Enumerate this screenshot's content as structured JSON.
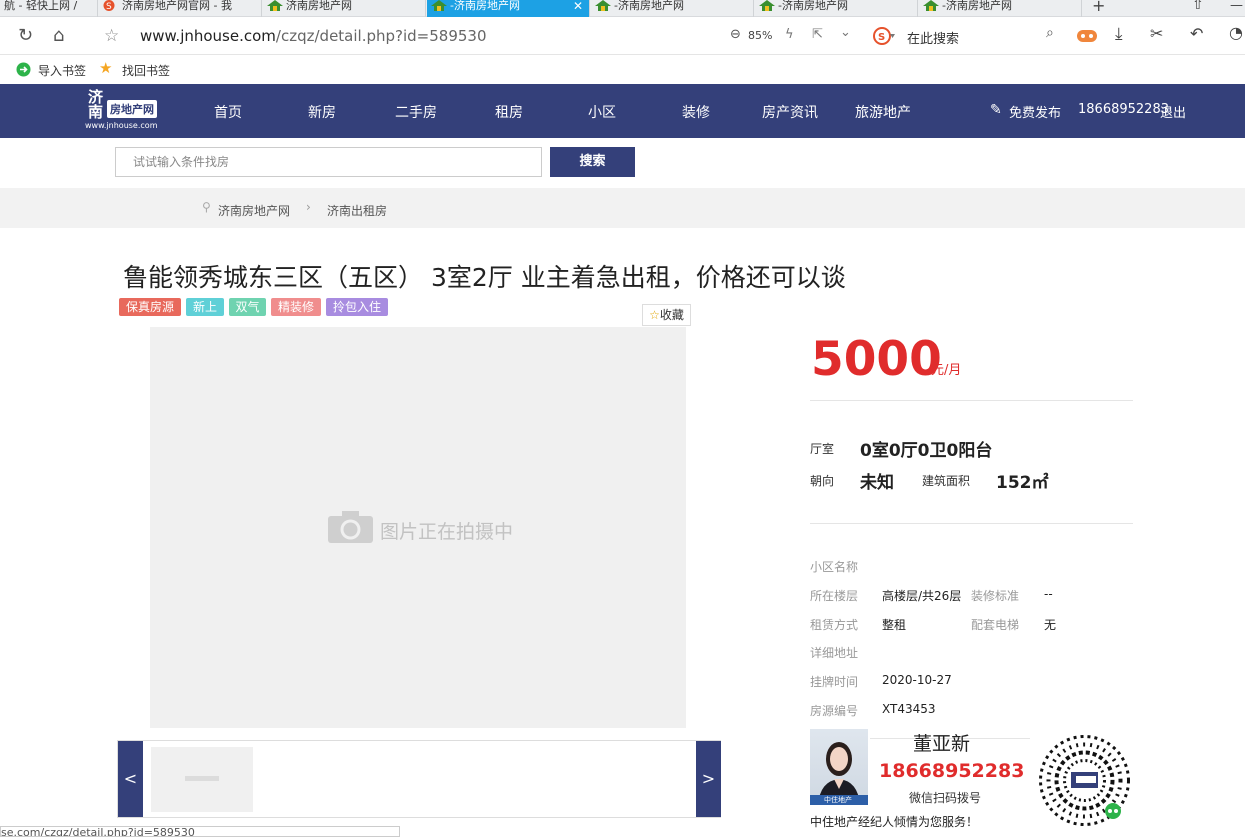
{
  "browser": {
    "tabs": [
      {
        "label": "航 - 轻快上网 /",
        "active": false
      },
      {
        "label": "济南房地产网官网 - 我",
        "active": false
      },
      {
        "label": "济南房地产网",
        "active": false
      },
      {
        "label": "-济南房地产网",
        "active": true
      },
      {
        "label": "-济南房地产网",
        "active": false
      },
      {
        "label": "-济南房地产网",
        "active": false
      },
      {
        "label": "-济南房地产网",
        "active": false
      }
    ],
    "new_tab": "+",
    "url_host": "www.jnhouse.com",
    "url_path": "/czqz/detail.php?id=589530",
    "zoom": "85%",
    "search_placeholder": "在此搜索",
    "bookmarks": [
      "导入书签",
      "找回书签"
    ],
    "status_url": "se.com/czqz/detail.php?id=589530"
  },
  "site": {
    "logo_top": "济南",
    "logo_badge": "房地产网",
    "logo_url": "www.jnhouse.com",
    "nav": [
      "首页",
      "新房",
      "二手房",
      "租房",
      "小区",
      "装修",
      "房产资讯",
      "旅游地产"
    ],
    "publish": "免费发布",
    "phone": "18668952283",
    "logout": "退出",
    "search_placeholder": "试试输入条件找房",
    "search_button": "搜索",
    "breadcrumb": [
      "济南房地产网",
      "济南出租房"
    ]
  },
  "listing": {
    "title": "鲁能领秀城东三区（五区） 3室2厅 业主着急出租，价格还可以谈",
    "tags": [
      {
        "label": "保真房源",
        "color": "#e8695c"
      },
      {
        "label": "新上",
        "color": "#5fd0d7"
      },
      {
        "label": "双气",
        "color": "#6fd3b0"
      },
      {
        "label": "精装修",
        "color": "#f08d8d"
      },
      {
        "label": "拎包入住",
        "color": "#a88ce0"
      }
    ],
    "favorite": "收藏",
    "photo_placeholder": "图片正在拍摄中",
    "prev": "<",
    "next": ">",
    "price": "5000",
    "price_unit": "元/月",
    "layout_label": "厅室",
    "layout_value": "0室0厅0卫0阳台",
    "orientation_label": "朝向",
    "orientation_value": "未知",
    "area_label": "建筑面积",
    "area_value": "152㎡",
    "community_label": "小区名称",
    "floor_label": "所在楼层",
    "floor_value": "高楼层/共26层",
    "decor_label": "装修标准",
    "decor_value": "--",
    "rent_label": "租赁方式",
    "rent_value": "整租",
    "elevator_label": "配套电梯",
    "elevator_value": "无",
    "address_label": "详细地址",
    "date_label": "挂牌时间",
    "date_value": "2020-10-27",
    "code_label": "房源编号",
    "code_value": "XT43453"
  },
  "agent": {
    "name": "董亚新",
    "phone": "18668952283",
    "scan_hint": "微信扫码拨号",
    "slogan": "中住地产经纪人倾情为您服务！",
    "badge": "中住地产"
  }
}
